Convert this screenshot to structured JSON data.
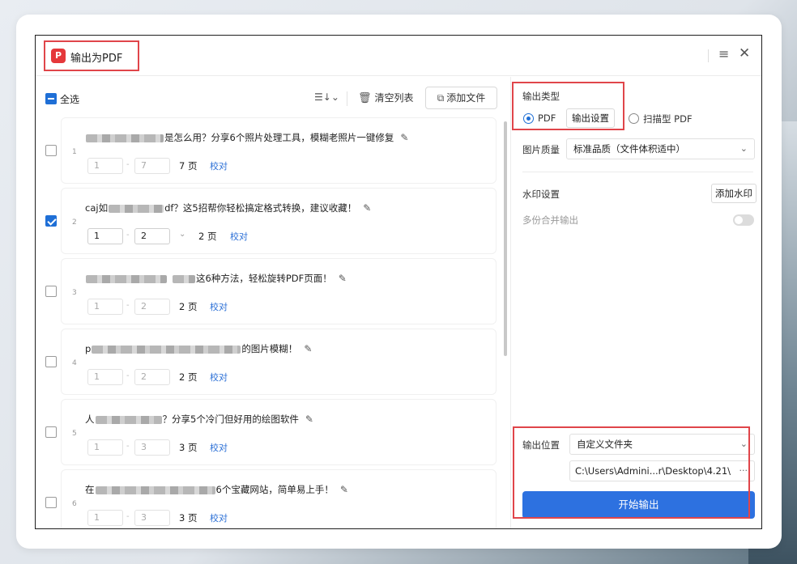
{
  "window": {
    "title": "输出为PDF",
    "logo_glyph": "P",
    "menu_glyph": "≡",
    "close_glyph": "✕"
  },
  "toolbar": {
    "select_all": "全选",
    "sort_glyph": "☰↓⌄",
    "clear_list": "清空列表",
    "add_file": "添加文件"
  },
  "files": [
    {
      "index": "1",
      "checked": false,
      "name_prefix": "",
      "name_suffix": "是怎么用？分享6个照片处理工具，模糊老照片一键修复",
      "from": "1",
      "to": "7",
      "pages": "7 页",
      "proof": "校对"
    },
    {
      "index": "2",
      "checked": true,
      "name_prefix": "caj如",
      "name_suffix": "df？这5招帮你轻松搞定格式转换，建议收藏！",
      "from": "1",
      "to": "2",
      "pages": "2 页",
      "proof": "校对"
    },
    {
      "index": "3",
      "checked": false,
      "name_prefix": "",
      "name_suffix": "这6种方法，轻松旋转PDF页面！",
      "from": "1",
      "to": "2",
      "pages": "2 页",
      "proof": "校对"
    },
    {
      "index": "4",
      "checked": false,
      "name_prefix": "p",
      "name_suffix": "的图片模糊！",
      "from": "1",
      "to": "2",
      "pages": "2 页",
      "proof": "校对"
    },
    {
      "index": "5",
      "checked": false,
      "name_prefix": "人",
      "name_suffix": "？分享5个冷门但好用的绘图软件",
      "from": "1",
      "to": "3",
      "pages": "3 页",
      "proof": "校对"
    },
    {
      "index": "6",
      "checked": false,
      "name_prefix": "在",
      "name_suffix": "6个宝藏网站，简单易上手！",
      "from": "1",
      "to": "3",
      "pages": "3 页",
      "proof": "校对"
    }
  ],
  "settings": {
    "output_type_label": "输出类型",
    "type_pdf": "PDF",
    "output_settings": "输出设置",
    "type_scan_pdf": "扫描型 PDF",
    "image_quality_label": "图片质量",
    "image_quality_value": "标准品质（文件体积适中）",
    "watermark_label": "水印设置",
    "add_watermark": "添加水印",
    "merge_label": "多份合并输出",
    "merge_on": false,
    "output_location_label": "输出位置",
    "output_location_value": "自定义文件夹",
    "output_path": "C:\\Users\\Admini...r\\Desktop\\4.21\\",
    "more_glyph": "···",
    "start": "开始输出"
  },
  "colors": {
    "accent": "#2d71e0",
    "highlight": "#e0454a",
    "logo": "#e5383b"
  }
}
